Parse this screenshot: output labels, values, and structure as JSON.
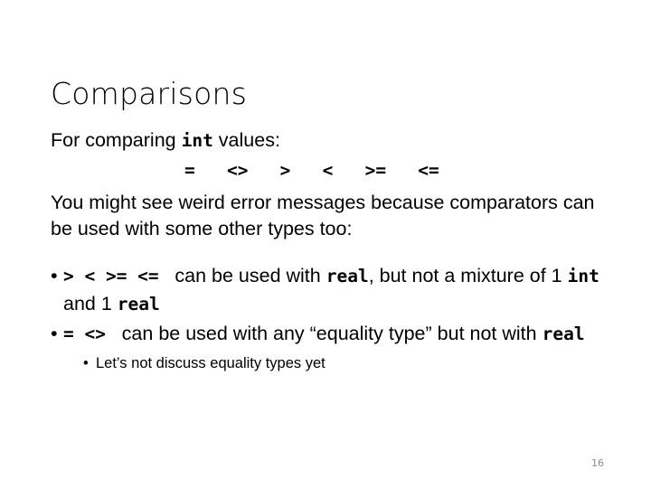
{
  "slide": {
    "title": "Comparisons",
    "page_number": "16",
    "lead": {
      "before": "For comparing ",
      "code": "int",
      "after": " values:"
    },
    "operators_line": "=   <>   >   <   >=   <=",
    "paragraph": "You might see weird error messages because comparators can be used with some other types too:",
    "bullets": [
      {
        "marker": "•",
        "ops": "> < >= <= ",
        "text_before": " can be used with ",
        "code1": "real",
        "text_middle": ", but not a mixture of 1 ",
        "code2": "int",
        "text_after": " and 1 ",
        "code3": "real"
      },
      {
        "marker": "•",
        "ops": "= <> ",
        "text_before": " can be used with any “equality type” but not with ",
        "code1": "real"
      }
    ],
    "subbullets": [
      {
        "marker": "•",
        "text": "Let’s not discuss equality types yet"
      }
    ]
  }
}
